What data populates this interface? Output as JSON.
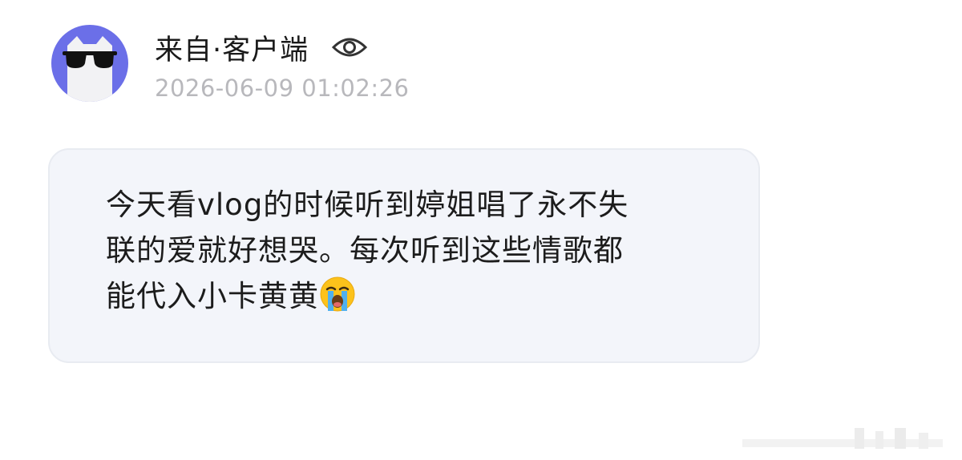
{
  "post": {
    "sender": "来自·客户端",
    "timestamp": "2026-06-09 01:02:26",
    "sender_icon": "eye-icon",
    "avatar": "cat-with-sunglasses",
    "message": {
      "line1": "今天看vlog的时候听到婷姐唱了永不失",
      "line2": "联的爱就好想哭。每次听到这些情歌都",
      "line3": "能代入小卡黄黄",
      "emoji": "loudly-crying-face"
    }
  },
  "colors": {
    "avatar_bg": "#6b6fe8",
    "bubble_bg": "#f3f5fa",
    "timestamp": "#b8b8bc",
    "text": "#1c1c1c"
  }
}
